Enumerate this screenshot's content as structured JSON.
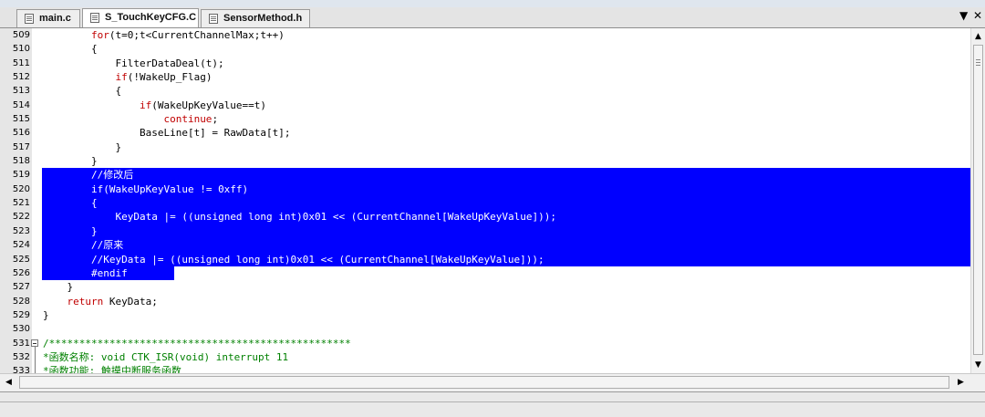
{
  "tabs": [
    {
      "label": "main.c",
      "active": false
    },
    {
      "label": "S_TouchKeyCFG.C",
      "active": true
    },
    {
      "label": "SensorMethod.h",
      "active": false
    }
  ],
  "tab_controls": {
    "menu_icon": "chevron-down-icon",
    "close_icon": "close-icon"
  },
  "colors": {
    "selection": "#0000ff",
    "keyword": "#c00000",
    "comment": "#008000",
    "gutter": "#e6e6e6"
  },
  "code_lines": [
    {
      "num": "509",
      "tokens": [
        {
          "t": "        "
        },
        {
          "t": "for",
          "c": "kw"
        },
        {
          "t": "(t=0;t<CurrentChannelMax;t++)"
        }
      ]
    },
    {
      "num": "510",
      "tokens": [
        {
          "t": "        {"
        }
      ]
    },
    {
      "num": "511",
      "tokens": [
        {
          "t": "            FilterDataDeal(t);"
        }
      ]
    },
    {
      "num": "512",
      "tokens": [
        {
          "t": "            "
        },
        {
          "t": "if",
          "c": "kw"
        },
        {
          "t": "(!WakeUp_Flag)"
        }
      ]
    },
    {
      "num": "513",
      "tokens": [
        {
          "t": "            {"
        }
      ]
    },
    {
      "num": "514",
      "tokens": [
        {
          "t": "                "
        },
        {
          "t": "if",
          "c": "kw"
        },
        {
          "t": "(WakeUpKeyValue==t)"
        }
      ]
    },
    {
      "num": "515",
      "tokens": [
        {
          "t": "                    "
        },
        {
          "t": "continue",
          "c": "kw"
        },
        {
          "t": ";"
        }
      ]
    },
    {
      "num": "516",
      "tokens": [
        {
          "t": "                BaseLine[t] = RawData[t];"
        }
      ]
    },
    {
      "num": "517",
      "tokens": [
        {
          "t": "            }"
        }
      ]
    },
    {
      "num": "518",
      "tokens": [
        {
          "t": "        }"
        }
      ]
    },
    {
      "num": "519",
      "selected": true,
      "tokens": [
        {
          "t": "        //修改后",
          "c": "cm"
        }
      ]
    },
    {
      "num": "520",
      "selected": true,
      "tokens": [
        {
          "t": "        "
        },
        {
          "t": "if",
          "c": "kw"
        },
        {
          "t": "(WakeUpKeyValue != 0xff)"
        }
      ]
    },
    {
      "num": "521",
      "selected": true,
      "tokens": [
        {
          "t": "        {"
        }
      ]
    },
    {
      "num": "522",
      "selected": true,
      "tokens": [
        {
          "t": "            KeyData |= (("
        },
        {
          "t": "unsigned long int",
          "c": "kw"
        },
        {
          "t": ")0x01 << (CurrentChannel[WakeUpKeyValue]));"
        }
      ]
    },
    {
      "num": "523",
      "selected": true,
      "tokens": [
        {
          "t": "        }"
        }
      ]
    },
    {
      "num": "524",
      "selected": true,
      "tokens": [
        {
          "t": "        //原来",
          "c": "cm"
        }
      ]
    },
    {
      "num": "525",
      "selected": true,
      "tokens": [
        {
          "t": "        //KeyData |= ((unsigned long int)0x01 << (CurrentChannel[WakeUpKeyValue]));",
          "c": "cm"
        }
      ]
    },
    {
      "num": "526",
      "selected": true,
      "partial": true,
      "tokens": [
        {
          "t": "        #endif"
        }
      ]
    },
    {
      "num": "527",
      "tokens": [
        {
          "t": "    }"
        }
      ]
    },
    {
      "num": "528",
      "tokens": [
        {
          "t": "    "
        },
        {
          "t": "return",
          "c": "kw"
        },
        {
          "t": " KeyData;"
        }
      ]
    },
    {
      "num": "529",
      "tokens": [
        {
          "t": "}"
        }
      ]
    },
    {
      "num": "530",
      "tokens": [
        {
          "t": ""
        }
      ]
    },
    {
      "num": "531",
      "fold": true,
      "tokens": [
        {
          "t": "/**************************************************",
          "c": "cm"
        }
      ]
    },
    {
      "num": "532",
      "tokens": [
        {
          "t": "*函数名称: void CTK_ISR(void) interrupt 11",
          "c": "cm"
        }
      ]
    },
    {
      "num": "533",
      "tokens": [
        {
          "t": "*函数功能: 触摸中断服务函数",
          "c": "cm"
        }
      ]
    }
  ]
}
